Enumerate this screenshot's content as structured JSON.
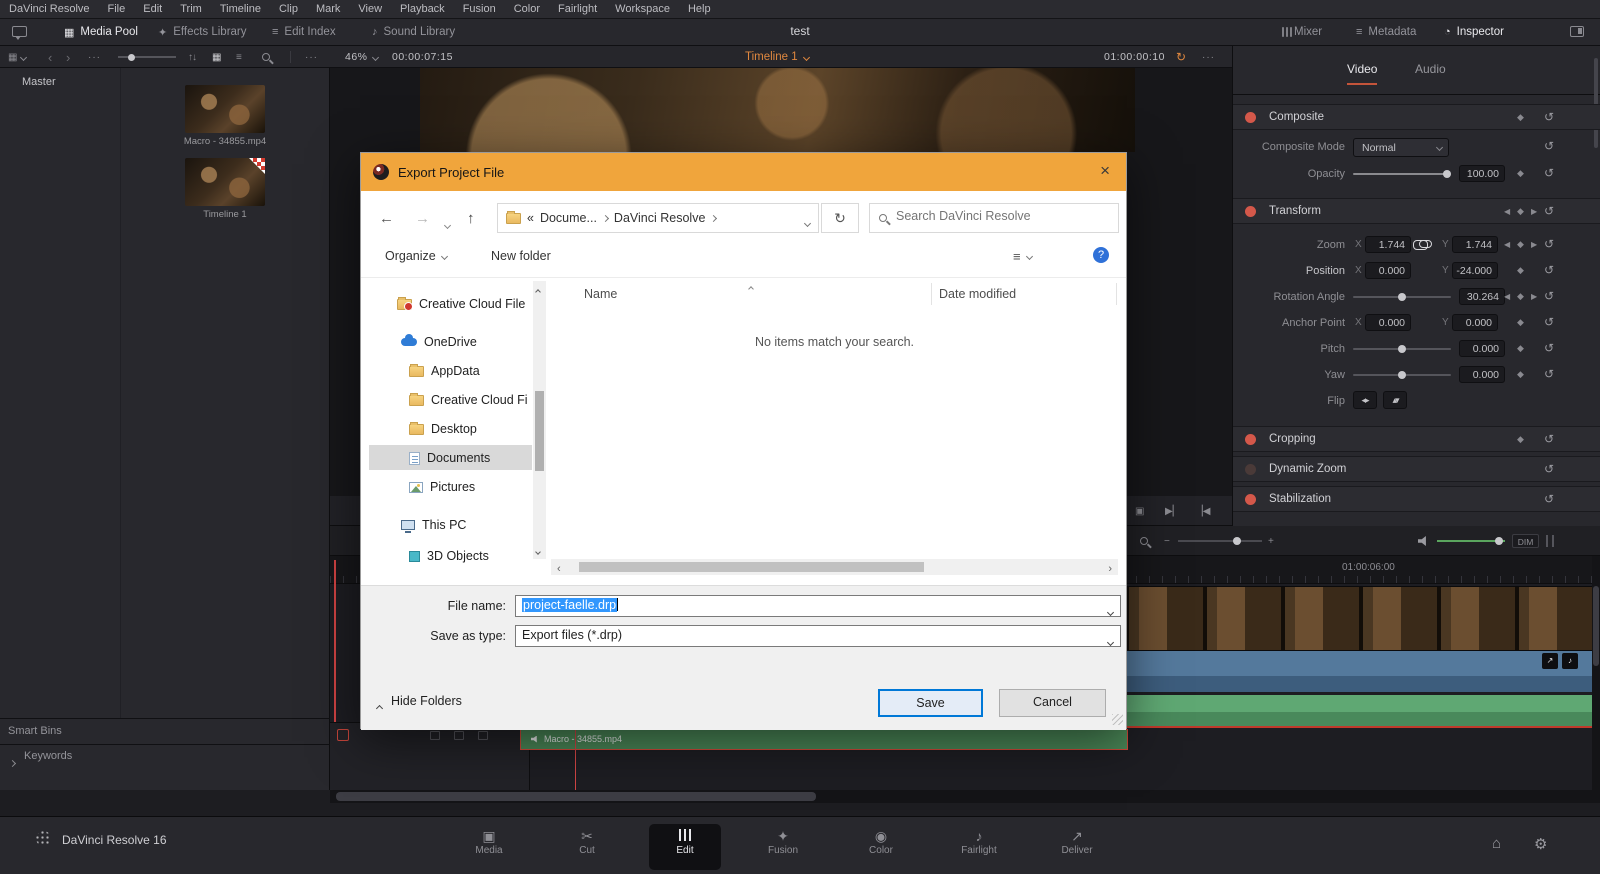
{
  "palette": {
    "dialog_titlebar": "#f0a53c",
    "selection_blue": "#3297fd",
    "focus_blue": "#0078d7",
    "toggle_red": "#d4584a",
    "accent_orange": "#e0883f",
    "tab_underline": "#c4543a",
    "clip_blue": "#54799c",
    "clip_green": "#55a06a"
  },
  "menubar": {
    "items": [
      "DaVinci Resolve",
      "File",
      "Edit",
      "Trim",
      "Timeline",
      "Clip",
      "Mark",
      "View",
      "Playback",
      "Fusion",
      "Color",
      "Fairlight",
      "Workspace",
      "Help"
    ]
  },
  "topbar": {
    "media_pool": "Media Pool",
    "effects_library": "Effects Library",
    "edit_index": "Edit Index",
    "sound_library": "Sound Library",
    "title": "test",
    "mixer": "Mixer",
    "metadata": "Metadata",
    "inspector": "Inspector"
  },
  "viewer_bar": {
    "zoom": "46%",
    "tc_left": "00:00:07:15",
    "timeline_tab": "Timeline 1",
    "tc_right": "01:00:00:10"
  },
  "media_pool": {
    "bin": "Master",
    "clip1": "Macro - 34855.mp4",
    "clip2": "Timeline 1",
    "smart_bins": "Smart Bins",
    "keywords": "Keywords"
  },
  "dialog": {
    "title": "Export Project File",
    "breadcrumb_prefix": "«",
    "breadcrumb_1": "Docume...",
    "breadcrumb_2": "DaVinci Resolve",
    "search_placeholder": "Search DaVinci Resolve",
    "organize": "Organize",
    "new_folder": "New folder",
    "sidebar": [
      {
        "label": "Creative Cloud File"
      },
      {
        "label": "OneDrive"
      },
      {
        "label": "AppData"
      },
      {
        "label": "Creative Cloud Fi"
      },
      {
        "label": "Desktop"
      },
      {
        "label": "Documents"
      },
      {
        "label": "Pictures"
      },
      {
        "label": "This PC"
      },
      {
        "label": "3D Objects"
      }
    ],
    "col_name": "Name",
    "col_date": "Date modified",
    "empty_message": "No items match your search.",
    "file_name_label": "File name:",
    "file_name_value": "project-faelle.drp",
    "save_as_type_label": "Save as type:",
    "save_as_type_value": "Export files (*.drp)",
    "hide_folders": "Hide Folders",
    "save": "Save",
    "cancel": "Cancel"
  },
  "inspector": {
    "tab_video": "Video",
    "tab_audio": "Audio",
    "composite_title": "Composite",
    "composite_mode_label": "Composite Mode",
    "composite_mode_value": "Normal",
    "opacity_label": "Opacity",
    "opacity_value": "100.00",
    "transform_title": "Transform",
    "zoom_label": "Zoom",
    "zoom_x": "1.744",
    "zoom_y": "1.744",
    "position_label": "Position",
    "position_x": "0.000",
    "position_y": "-24.000",
    "rotation_label": "Rotation Angle",
    "rotation_value": "30.264",
    "anchor_label": "Anchor Point",
    "anchor_x": "0.000",
    "anchor_y": "0.000",
    "pitch_label": "Pitch",
    "pitch_value": "0.000",
    "yaw_label": "Yaw",
    "yaw_value": "0.000",
    "flip_label": "Flip",
    "x_axis": "X",
    "y_axis": "Y",
    "cropping_title": "Cropping",
    "dynamic_zoom_title": "Dynamic Zoom",
    "stabilization_title": "Stabilization"
  },
  "timeline": {
    "ruler_tc": "01:00:06:00",
    "clip_label": "Macro - 34855.mp4",
    "dim": "DIM"
  },
  "bottombar": {
    "app": "DaVinci Resolve 16",
    "pages": [
      "Media",
      "Cut",
      "Edit",
      "Fusion",
      "Color",
      "Fairlight",
      "Deliver"
    ]
  }
}
